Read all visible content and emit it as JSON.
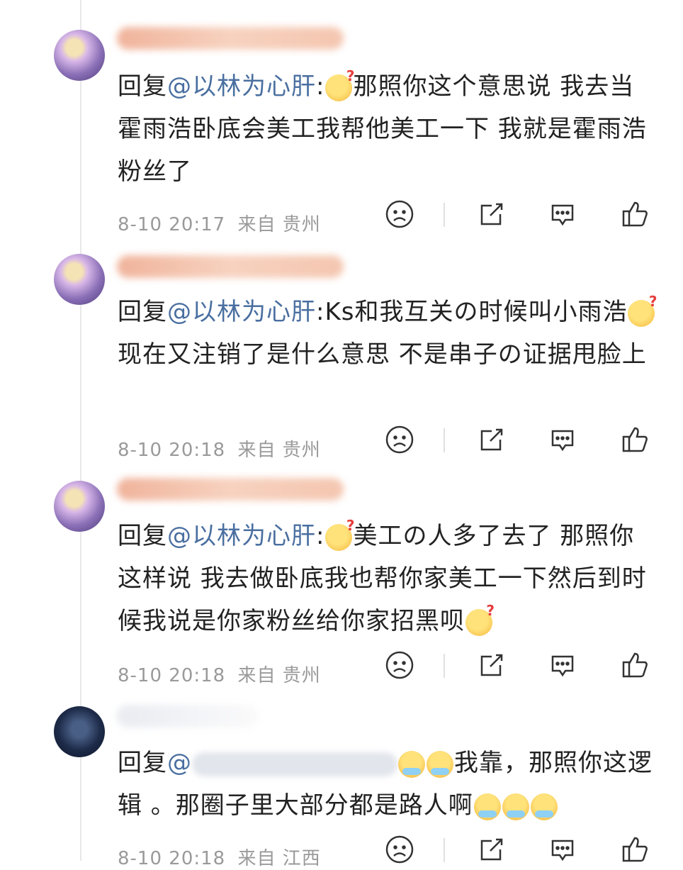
{
  "colors": {
    "mention": "#4a6fa0",
    "meta": "#9a9a9a",
    "text": "#222222"
  },
  "reply_prefix": "回复",
  "comments": [
    {
      "mention": "@以林为心肝",
      "colon": ":",
      "text_after_emoji": "那照你这个意思说  我去当霍雨浩卧底会美工我帮他美工一下 我就是霍雨浩粉丝了",
      "date": "8-10 20:17",
      "location": "来自 贵州"
    },
    {
      "mention": "@以林为心肝",
      "colon": ":",
      "text_before_emoji": "Ks和我互关の时候叫小雨浩",
      "text_after_emoji": "现在又注销了是什么意思 不是串子の证据甩脸上",
      "date": "8-10 20:18",
      "location": "来自 贵州"
    },
    {
      "mention": "@以林为心肝",
      "colon": ":",
      "text_after_emoji": "美工の人多了去了 那照你这样说 我去做卧底我也帮你家美工一下然后到时候我说是你家粉丝给你家招黑呗",
      "date": "8-10 20:18",
      "location": "来自 贵州"
    },
    {
      "mention": "@",
      "text_after_emoji": "我靠，那照你这逻辑 。那圈子里大部分都是路人啊",
      "date": "8-10 20:18",
      "location": "来自 江西"
    }
  ],
  "icons": [
    "sad-face-icon",
    "share-icon",
    "comment-icon",
    "like-icon"
  ]
}
